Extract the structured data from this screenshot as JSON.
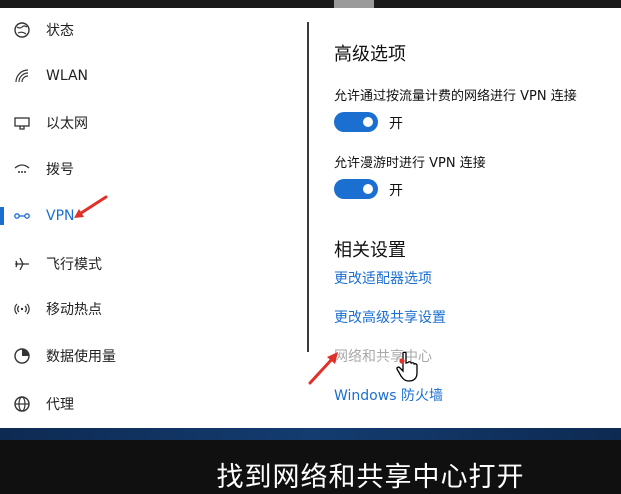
{
  "sidebar": {
    "items": [
      {
        "label": "状态",
        "icon": "status-globe-icon"
      },
      {
        "label": "WLAN",
        "icon": "wifi-icon"
      },
      {
        "label": "以太网",
        "icon": "ethernet-icon"
      },
      {
        "label": "拨号",
        "icon": "dialup-icon"
      },
      {
        "label": "VPN",
        "icon": "vpn-icon",
        "selected": true
      },
      {
        "label": "飞行模式",
        "icon": "airplane-icon"
      },
      {
        "label": "移动热点",
        "icon": "hotspot-icon"
      },
      {
        "label": "数据使用量",
        "icon": "data-usage-icon"
      },
      {
        "label": "代理",
        "icon": "proxy-globe-icon"
      }
    ]
  },
  "advanced": {
    "title": "高级选项",
    "option1": {
      "text": "允许通过按流量计费的网络进行 VPN 连接",
      "state": "开"
    },
    "option2": {
      "text": "允许漫游时进行 VPN 连接",
      "state": "开"
    }
  },
  "related": {
    "title": "相关设置",
    "links": [
      "更改适配器选项",
      "更改高级共享设置",
      "网络和共享中心",
      "Windows 防火墙"
    ]
  },
  "subtitle": "找到网络和共享中心打开",
  "colors": {
    "accent": "#1a6fd0",
    "annotation_arrow": "#e0302a"
  }
}
